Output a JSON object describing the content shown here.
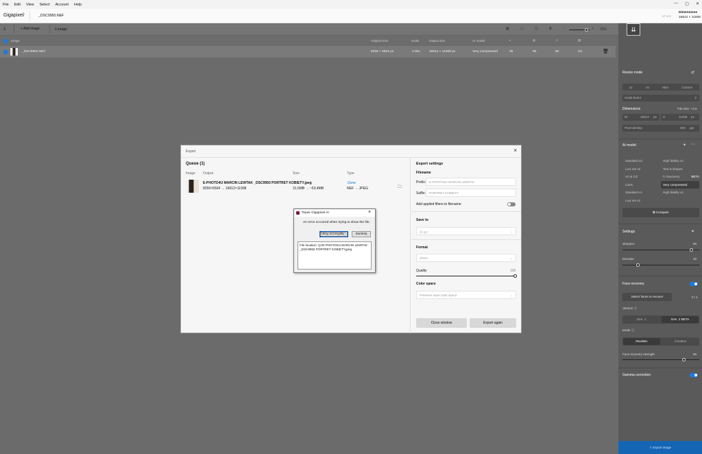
{
  "menu": [
    "File",
    "Edit",
    "View",
    "Select",
    "Account",
    "Help"
  ],
  "app": {
    "name": "Gigapixel",
    "version_major": "7",
    "filename": "_DSC9950.NEF",
    "version": "v7.4.2",
    "dim_label": "Dimensions",
    "dim_value": "16512 × 11008"
  },
  "toolbar": {
    "add_image": "Add image",
    "count": "1 image",
    "zoom": "25%"
  },
  "table": {
    "headers": {
      "image": "Image",
      "original": "Original size",
      "scale": "Scale",
      "output": "Output size",
      "model": "AI model"
    },
    "row": {
      "name": "_DSC9950.NEF",
      "original": "8256 × 5504 px",
      "scale": "2.00x",
      "output": "16512 × 11008 px",
      "model": "Very compressed",
      "v1": "35",
      "v2": "90",
      "v3": "80",
      "v4": "On"
    }
  },
  "panel": {
    "resize_mode": "Resize mode",
    "scale_options": [
      "1x",
      "2x",
      "Max",
      "Custom"
    ],
    "scale_factor_label": "Scale factor",
    "scale_factor_value": "2",
    "dimensions": "Dimensions",
    "file_size": "File size: ~2.0",
    "w_label": "W",
    "w_value": "16512",
    "w_unit": "px",
    "h_label": "H",
    "h_value": "11008",
    "h_unit": "px",
    "pixel_density": "Pixel density",
    "pixel_density_value": "300",
    "pixel_density_unit": "ppi",
    "ai_model": "AI model",
    "models_left": [
      "Standard v2",
      "Low res v2",
      "Art & CG",
      "Lines",
      "Standard v1",
      "Low res v1"
    ],
    "models_right": [
      "High fidelity v2",
      "Text & shapes",
      "Recovery",
      "Very compressed",
      "High fidelity v1"
    ],
    "beta": "BETA",
    "compare": "Compare",
    "settings": "Settings",
    "sharpen": "Sharpen",
    "sharpen_value": "90",
    "sharpen_level": 0.9,
    "denoise": "Denoise",
    "denoise_value": "20",
    "denoise_level": 0.2,
    "face_recovery": "Face recovery",
    "select_faces": "Select faces to recover",
    "faces_count": "0 / 1",
    "version": "Version",
    "gen1": "Gen. 1",
    "gen2": "Gen. 2",
    "gen2_badge": "BETA",
    "mode": "Mode",
    "realistic": "Realistic",
    "creative": "Creative",
    "strength": "Face recovery strength",
    "strength_value": "80",
    "strength_level": 0.8,
    "gamma": "Gamma correction",
    "export_image": "Export image"
  },
  "export": {
    "title": "Export",
    "queue": "Queue (1)",
    "cols": {
      "image": "Image",
      "output": "Output",
      "size": "Size",
      "type": "Type"
    },
    "item": {
      "filename": "E-PHOTO4U MARCIN LEWTAK _DSC9950 PORTRET KOBIETY.jpeg",
      "dims": "8256×5504 → 16512×11008",
      "size": "31,5MB → ~53,4MB",
      "status": "Done",
      "type": "NEF → JPEG"
    },
    "settings": "Export settings",
    "filename_label": "Filename",
    "prefix_label": "Prefix:",
    "prefix_value": "E-PHOTO4U MARCIN LEWTAK",
    "suffix_label": "Suffix:",
    "suffix_value": "PORTRET KOBIETY",
    "add_filters": "Add applied filters to filename",
    "save_to": "Save to",
    "save_path": "Q:/",
    "format": "Format",
    "format_value": "JPEG",
    "quality": "Quality",
    "quality_value": "100",
    "color_space": "Color space",
    "color_space_value": "Preserve input color space",
    "close_window": "Close window",
    "export_again": "Export again"
  },
  "error": {
    "title": "Topaz Gigapixel AI",
    "message": "An error occurred when trying to show the file.",
    "details_button": "Ukryj szczegóły...",
    "close_button": "Zamknij",
    "details": "File location: Q:/E-PHOTO4U MARCIN LEWTAK _DSC9950 PORTRET KOBIETY.jpeg"
  },
  "colors": {
    "accent": "#1e7bd6",
    "export_bar": "#1565b5"
  }
}
